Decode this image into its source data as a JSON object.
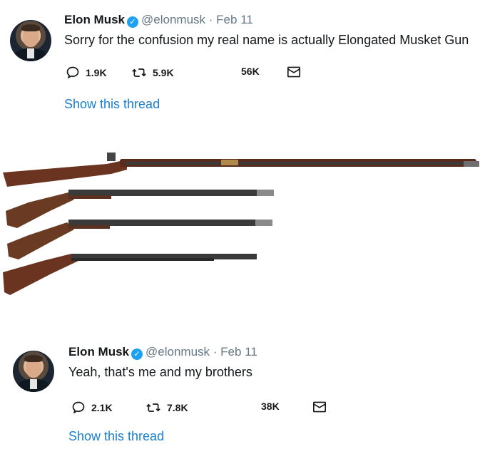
{
  "tweets": [
    {
      "name": "Elon Musk",
      "handle": "@elonmusk",
      "date": "Feb 11",
      "separator": "·",
      "text": "Sorry for the confusion my real name is actually Elongated Musket Gun",
      "replies": "1.9K",
      "retweets": "5.9K",
      "likes": "56K",
      "show_thread": "Show this thread"
    },
    {
      "name": "Elon Musk",
      "handle": "@elonmusk",
      "date": "Feb 11",
      "separator": "·",
      "text": "Yeah, that's me and my brothers",
      "replies": "2.1K",
      "retweets": "7.8K",
      "likes": "38K",
      "show_thread": "Show this thread"
    }
  ],
  "icons": {
    "reply": "reply-icon",
    "retweet": "retweet-icon",
    "dm": "envelope-icon",
    "verified": "verified-badge-icon"
  },
  "colors": {
    "link": "#1b7fd1",
    "verified": "#1da1f2",
    "text": "#14171a",
    "muted": "#657786"
  }
}
